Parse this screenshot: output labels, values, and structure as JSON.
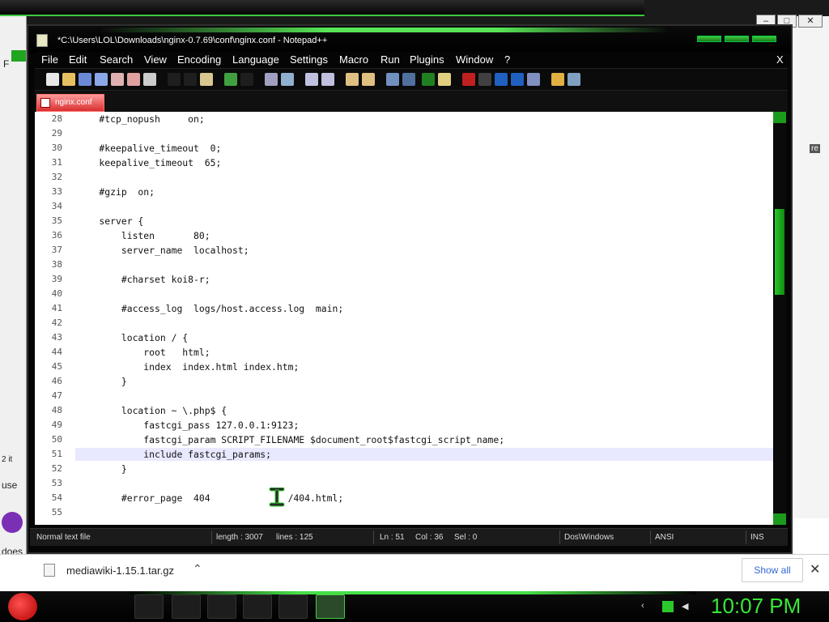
{
  "window": {
    "title": "*C:\\Users\\LOL\\Downloads\\nginx-0.7.69\\conf\\nginx.conf - Notepad++",
    "close_label": "X"
  },
  "menu": [
    "File",
    "Edit",
    "Search",
    "View",
    "Encoding",
    "Language",
    "Settings",
    "Macro",
    "Run",
    "Plugins",
    "Window",
    "?"
  ],
  "toolbar_icons": [
    "new-file-icon",
    "open-file-icon",
    "save-icon",
    "save-all-icon",
    "close-icon",
    "close-all-icon",
    "print-icon",
    "cut-icon",
    "copy-icon",
    "paste-icon",
    "undo-icon",
    "redo-icon",
    "find-icon",
    "replace-icon",
    "zoom-in-icon",
    "zoom-out-icon",
    "sync-v-icon",
    "sync-h-icon",
    "wrap-icon",
    "all-chars-icon",
    "indent-guide-icon",
    "user-lang-icon",
    "record-macro-icon",
    "stop-macro-icon",
    "play-macro-icon",
    "run-macro-multiple-icon",
    "save-macro-icon",
    "open-folder-icon",
    "spell-check-icon"
  ],
  "tab": {
    "label": "nginx.conf"
  },
  "editor": {
    "lines": [
      {
        "n": "28",
        "text": "    #tcp_nopush     on;"
      },
      {
        "n": "29",
        "text": ""
      },
      {
        "n": "30",
        "text": "    #keepalive_timeout  0;"
      },
      {
        "n": "31",
        "text": "    keepalive_timeout  65;"
      },
      {
        "n": "32",
        "text": ""
      },
      {
        "n": "33",
        "text": "    #gzip  on;"
      },
      {
        "n": "34",
        "text": ""
      },
      {
        "n": "35",
        "text": "    server {"
      },
      {
        "n": "36",
        "text": "        listen       80;"
      },
      {
        "n": "37",
        "text": "        server_name  localhost;"
      },
      {
        "n": "38",
        "text": ""
      },
      {
        "n": "39",
        "text": "        #charset koi8-r;"
      },
      {
        "n": "40",
        "text": ""
      },
      {
        "n": "41",
        "text": "        #access_log  logs/host.access.log  main;"
      },
      {
        "n": "42",
        "text": ""
      },
      {
        "n": "43",
        "text": "        location / {"
      },
      {
        "n": "44",
        "text": "            root   html;"
      },
      {
        "n": "45",
        "text": "            index  index.html index.htm;"
      },
      {
        "n": "46",
        "text": "        }"
      },
      {
        "n": "47",
        "text": ""
      },
      {
        "n": "48",
        "text": "        location ~ \\.php$ {"
      },
      {
        "n": "49",
        "text": "            fastcgi_pass 127.0.0.1:9123;"
      },
      {
        "n": "50",
        "text": "            fastcgi_param SCRIPT_FILENAME $document_root$fastcgi_script_name;"
      },
      {
        "n": "51",
        "text": "            include fastcgi_params;"
      },
      {
        "n": "52",
        "text": "        }"
      },
      {
        "n": "53",
        "text": ""
      },
      {
        "n": "54",
        "text": "        #error_page  404              /404.html;"
      },
      {
        "n": "55",
        "text": ""
      }
    ],
    "current_line": "51"
  },
  "status": {
    "mode": "Normal text file",
    "length": "length : 3007",
    "lines": "lines : 125",
    "ln": "Ln : 51",
    "col": "Col : 36",
    "sel": "Sel : 0",
    "eol": "Dos\\Windows",
    "encoding": "ANSI",
    "ins": "INS"
  },
  "download": {
    "file": "mediawiki-1.15.1.tar.gz",
    "show_all": "Show all",
    "close": "✕"
  },
  "taskbar": {
    "clock": "10:07 PM",
    "tasks": [
      "explorer-icon",
      "chrome-icon",
      "7zip-icon",
      "app-icon",
      "network-icon",
      "notepadpp-icon"
    ]
  },
  "background": {
    "left_fragments": [
      "F",
      "2 it",
      "use",
      "does"
    ],
    "right_fragments": [
      "re"
    ]
  },
  "colors": {
    "accent": "#3ec83e",
    "current_line": "#e8e8ff"
  }
}
